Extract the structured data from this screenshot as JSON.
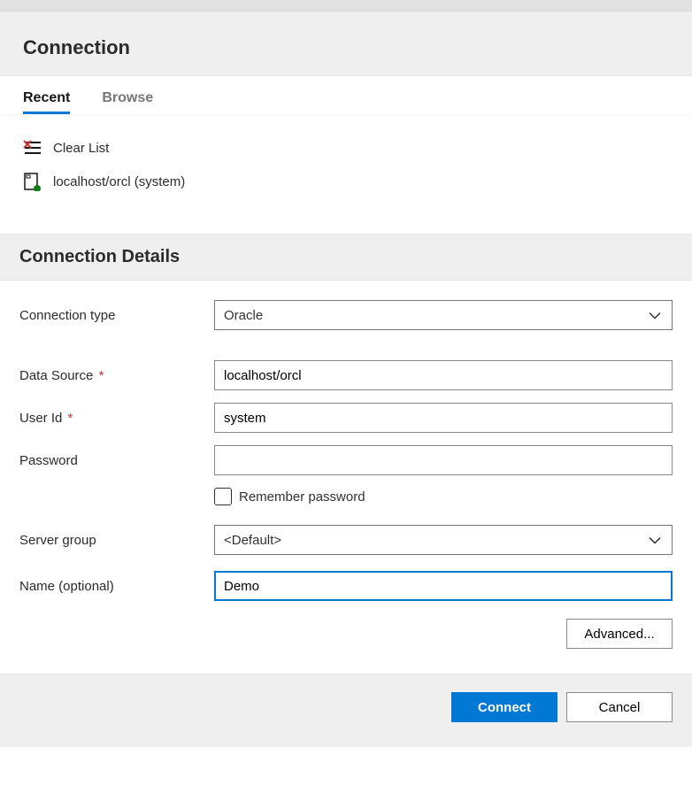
{
  "header": {
    "title": "Connection"
  },
  "tabs": {
    "recent": "Recent",
    "browse": "Browse"
  },
  "recent": {
    "clear_list": "Clear List",
    "item0": "localhost/orcl (system)"
  },
  "details": {
    "title": "Connection Details",
    "labels": {
      "connection_type": "Connection type",
      "data_source": "Data Source",
      "user_id": "User Id",
      "password": "Password",
      "remember": "Remember password",
      "server_group": "Server group",
      "name": "Name (optional)"
    },
    "values": {
      "connection_type": "Oracle",
      "data_source": "localhost/orcl",
      "user_id": "system",
      "password": "",
      "server_group": "<Default>",
      "name": "Demo"
    },
    "required_mark": "*"
  },
  "actions": {
    "advanced": "Advanced...",
    "connect": "Connect",
    "cancel": "Cancel"
  }
}
